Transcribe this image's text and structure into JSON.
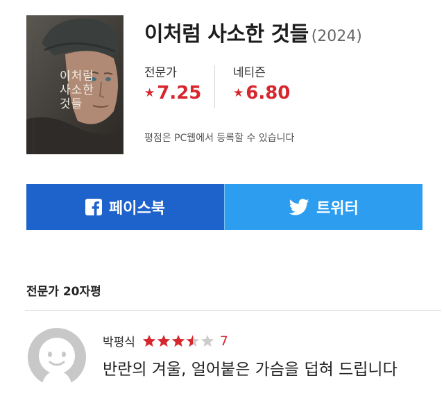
{
  "movie": {
    "title": "이처럼 사소한 것들",
    "year": "(2024)",
    "poster_title": "이처럼\n사소한\n것들"
  },
  "ratings": {
    "critic": {
      "label": "전문가",
      "value": "7.25"
    },
    "netizen": {
      "label": "네티즌",
      "value": "6.80"
    },
    "star_glyph": "★",
    "note": "평점은 PC웹에서 등록할 수 있습니다"
  },
  "share": {
    "facebook_label": "페이스북",
    "twitter_label": "트위터"
  },
  "reviews_section": {
    "title": "전문가 20자평",
    "items": [
      {
        "author": "박평식",
        "score": "7",
        "star_rating": 3.5,
        "star_max": 5,
        "text": "반란의 겨울, 얼어붙은 가슴을 덥혀 드립니다"
      }
    ]
  },
  "colors": {
    "accent_red": "#d7262d",
    "facebook_blue": "#1e62cc",
    "twitter_blue": "#2d9df0",
    "star_empty": "#cccccc"
  }
}
